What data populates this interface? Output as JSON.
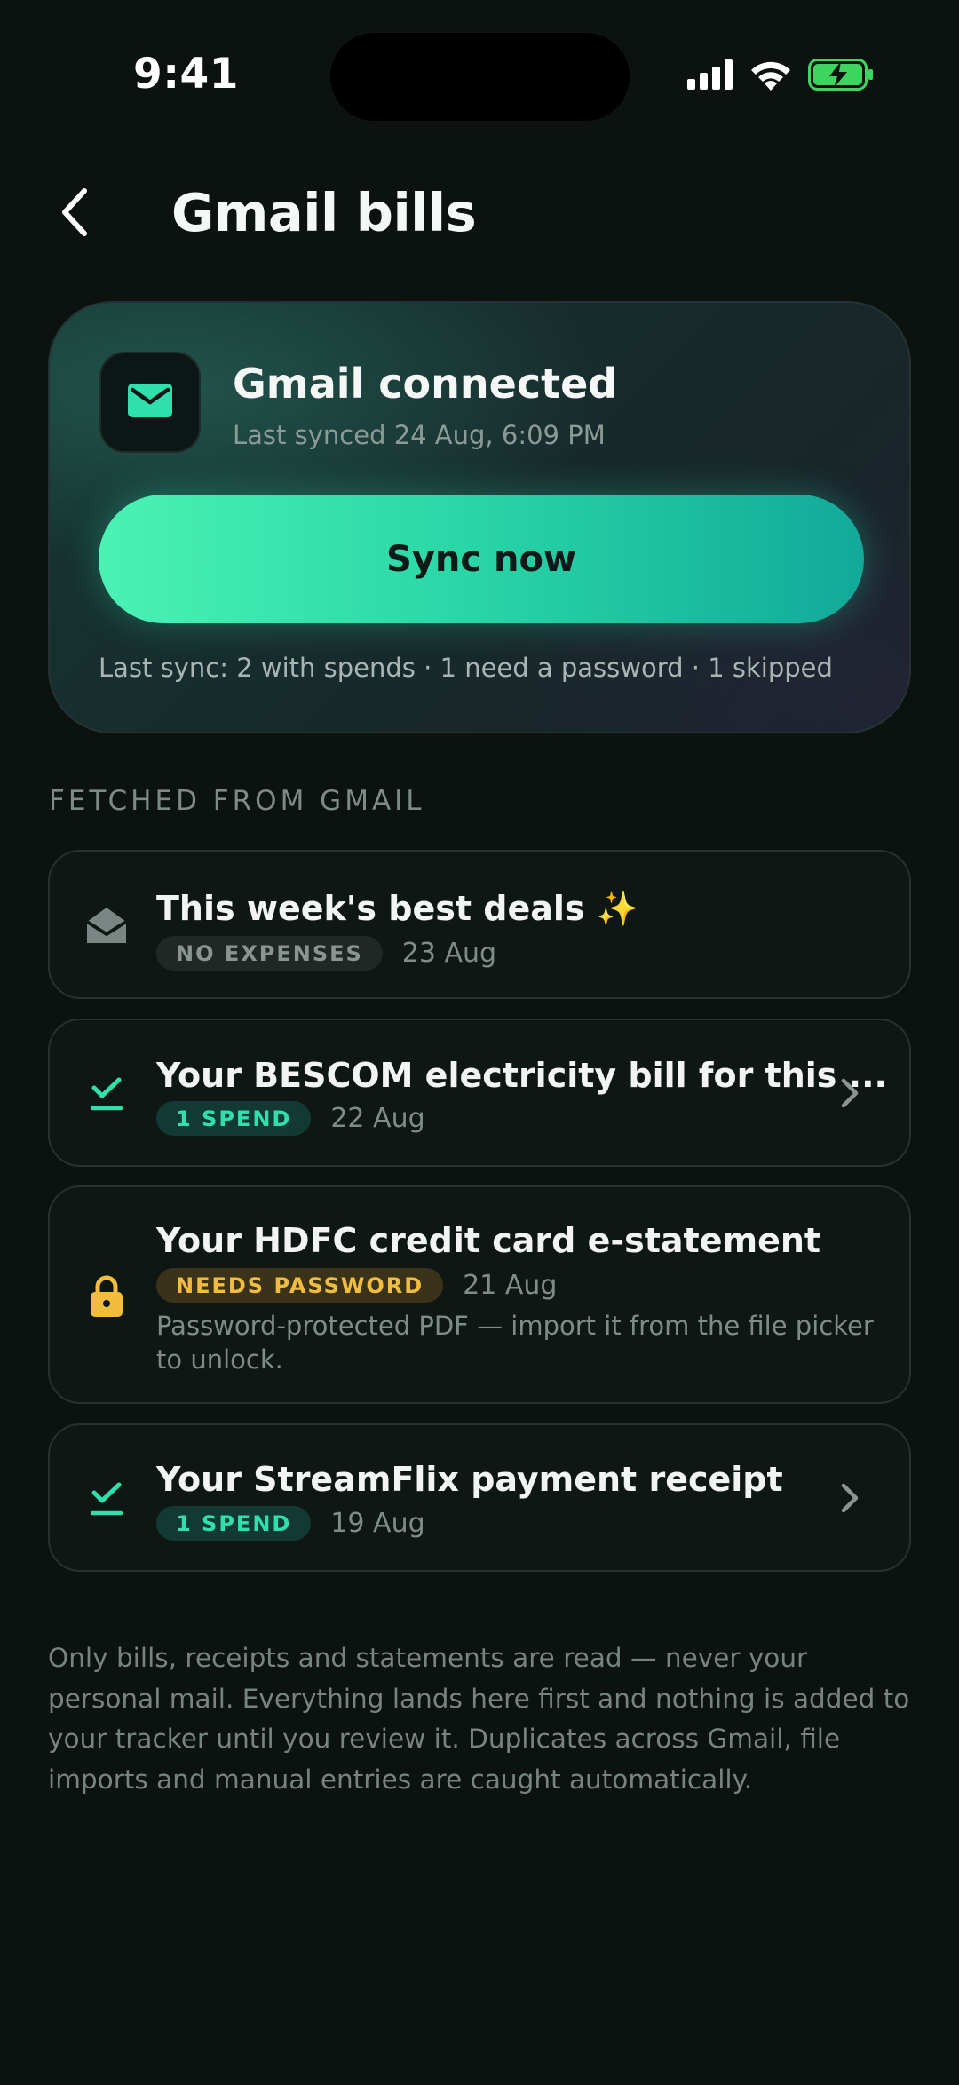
{
  "status_bar": {
    "time": "9:41",
    "icons": [
      "cellular-signal-icon",
      "wifi-icon",
      "battery-charging-icon"
    ]
  },
  "header": {
    "back_icon": "chevron-left-icon",
    "title": "Gmail bills"
  },
  "gmail_card": {
    "icon": "mail-icon",
    "title": "Gmail connected",
    "last_synced": "Last synced 24 Aug, 6:09 PM",
    "sync_button_label": "Sync now",
    "summary": "Last sync: 2 with spends · 1 need a password · 1 skipped"
  },
  "section": {
    "label": "FETCHED FROM GMAIL"
  },
  "items": [
    {
      "icon": "envelope-open-icon",
      "title": "This week's best deals ✨",
      "badge": "NO EXPENSES",
      "date": "23 Aug"
    },
    {
      "icon": "checkmark-icon",
      "title": "Your BESCOM electricity bill for this ...",
      "badge": "1 SPEND",
      "date": "22 Aug",
      "chevron_icon": "chevron-right-icon"
    },
    {
      "icon": "lock-icon",
      "title": "Your HDFC credit card e-statement",
      "badge": "NEEDS PASSWORD",
      "date": "21 Aug",
      "note": "Password-protected PDF — import it from the file picker to unlock."
    },
    {
      "icon": "checkmark-icon",
      "title": "Your StreamFlix payment receipt",
      "badge": "1 SPEND",
      "date": "19 Aug",
      "chevron_icon": "chevron-right-icon"
    }
  ],
  "footer_note": "Only bills, receipts and statements are read — never your personal mail. Everything lands here first and nothing is added to your tracker until you review it. Duplicates across Gmail, file imports and manual entries are caught automatically.",
  "colors": {
    "background": "#0b1210",
    "accent": "#2fe0ac",
    "warning": "#f2bd3d"
  }
}
